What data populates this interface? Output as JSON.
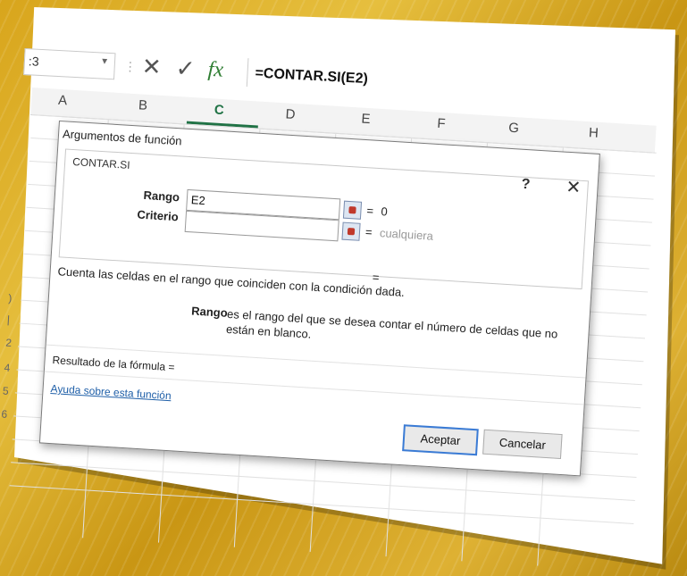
{
  "formula_bar": {
    "name_box": ":3",
    "cancel_glyph": "✕",
    "enter_glyph": "✓",
    "fx_glyph": "fx",
    "formula": "=CONTAR.SI(E2)"
  },
  "columns": [
    "A",
    "B",
    "C",
    "D",
    "E",
    "F",
    "G",
    "H"
  ],
  "active_column": "C",
  "rows": [
    ")",
    "|",
    "2",
    "4",
    "5",
    "6"
  ],
  "dialog": {
    "title": "Argumentos de función",
    "function_name": "CONTAR.SI",
    "help_glyph": "?",
    "close_glyph": "✕",
    "args": [
      {
        "label": "Rango",
        "value": "E2",
        "eq": "=",
        "result": "0"
      },
      {
        "label": "Criterio",
        "value": "",
        "eq": "=",
        "result": "cualquiera"
      }
    ],
    "description": "Cuenta las celdas en el rango que coinciden con la condición dada.",
    "mid_eq": "=",
    "arg_desc_label": "Rango",
    "arg_desc_text": "es el rango del que se desea contar el número de celdas que no están en blanco.",
    "result_label": "Resultado de la fórmula =",
    "help_link": "Ayuda sobre esta función",
    "ok_label": "Aceptar",
    "cancel_label": "Cancelar"
  }
}
